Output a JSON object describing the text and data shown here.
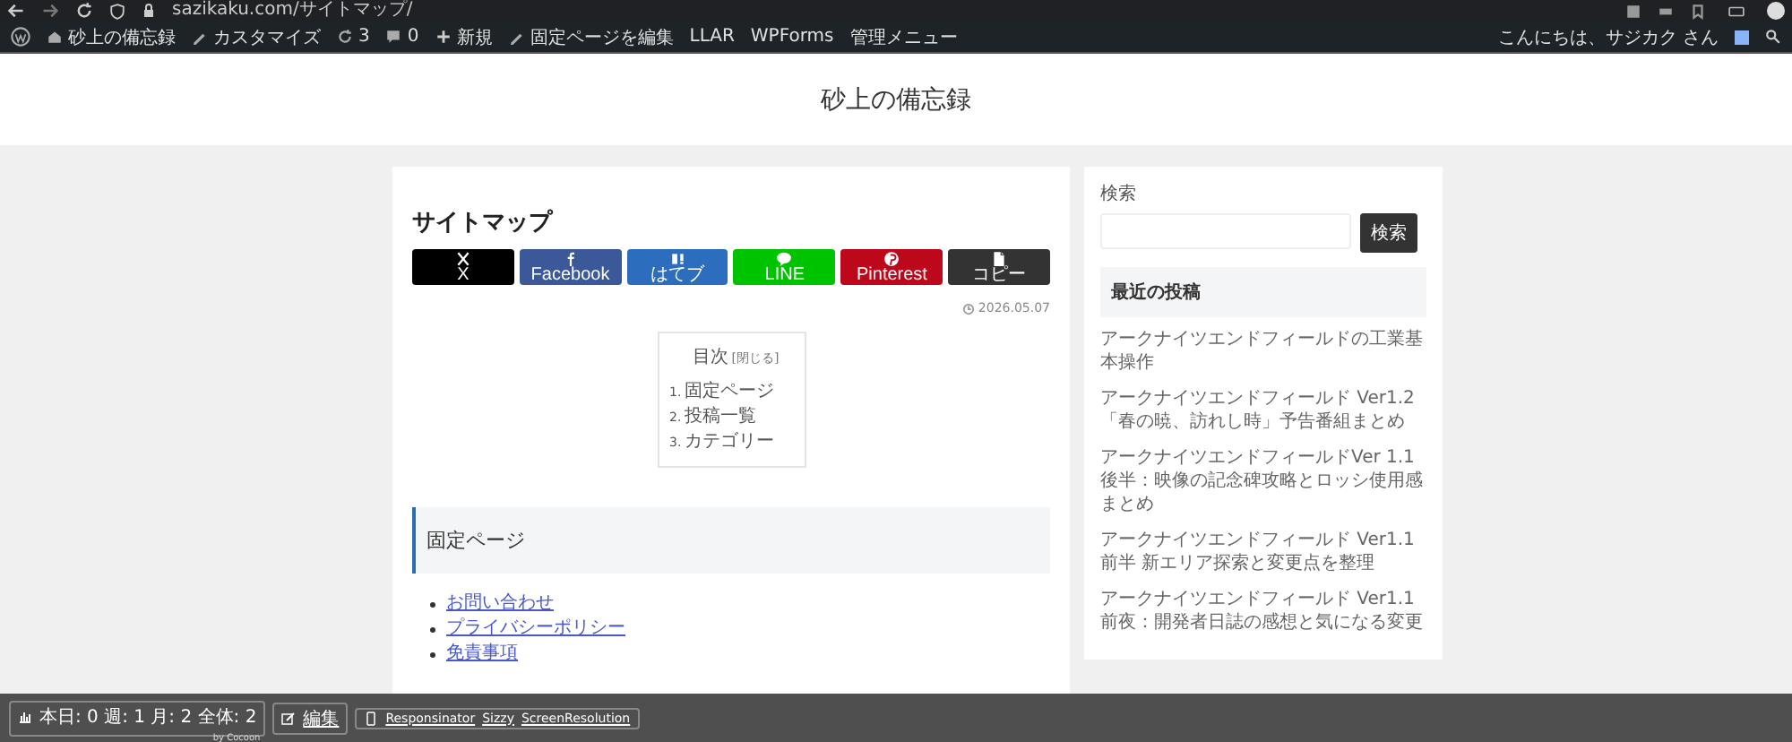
{
  "browser": {
    "url": "sazikaku.com/サイトマップ/"
  },
  "admin_bar": {
    "items": [
      {
        "kind": "logo"
      },
      {
        "kind": "site",
        "label": "砂上の備忘録"
      },
      {
        "kind": "customize",
        "label": "カスタマイズ"
      },
      {
        "kind": "updates",
        "label": "3"
      },
      {
        "kind": "comments",
        "label": "0"
      },
      {
        "kind": "new",
        "label": "新規"
      },
      {
        "kind": "edit",
        "label": "固定ページを編集"
      },
      {
        "kind": "text",
        "label": "LLAR"
      },
      {
        "kind": "text",
        "label": "WPForms"
      },
      {
        "kind": "text",
        "label": "管理メニュー"
      }
    ],
    "greeting": "こんにちは、サジカク さん"
  },
  "header": {
    "site_title": "砂上の備忘録"
  },
  "article": {
    "title": "サイトマップ",
    "share_buttons": [
      {
        "kind": "x",
        "label": "X",
        "color": "#000000"
      },
      {
        "kind": "facebook",
        "label": "Facebook",
        "color": "#3b5998"
      },
      {
        "kind": "hatena",
        "label": "はてブ",
        "color": "#2c6ebd"
      },
      {
        "kind": "line",
        "label": "LINE",
        "color": "#00c300"
      },
      {
        "kind": "pinterest",
        "label": "Pinterest",
        "color": "#bd081c"
      },
      {
        "kind": "copy",
        "label": "コピー",
        "color": "#333333"
      }
    ],
    "date": "2026.05.07",
    "toc": {
      "title": "目次",
      "toggle": "[閉じる]",
      "items": [
        {
          "number": "1.",
          "label": "固定ページ"
        },
        {
          "number": "2.",
          "label": "投稿一覧"
        },
        {
          "number": "3.",
          "label": "カテゴリー"
        }
      ]
    },
    "sections": [
      {
        "heading": "固定ページ",
        "links": [
          "お問い合わせ",
          "プライバシーポリシー",
          "免責事項"
        ]
      }
    ]
  },
  "sidebar": {
    "search": {
      "label": "検索",
      "button": "検索"
    },
    "recent": {
      "heading": "最近の投稿",
      "posts": [
        "アークナイツエンドフィールドの工業基本操作",
        "アークナイツエンドフィールド Ver1.2「春の暁、訪れし時」予告番組まとめ",
        "アークナイツエンドフィールドVer 1.1後半：映像の記念碑攻略とロッシ使用感まとめ",
        "アークナイツエンドフィールド Ver1.1前半 新エリア探索と変更点を整理",
        "アークナイツエンドフィールド Ver1.1前夜：開発者日誌の感想と気になる変更"
      ]
    }
  },
  "footer_bar": {
    "stats": "本日: 0  週: 1  月: 2  全体: 2",
    "credit": "by Cocoon",
    "edit": "編集",
    "tools": [
      "Responsinator",
      "Sizzy",
      "ScreenResolution"
    ]
  }
}
